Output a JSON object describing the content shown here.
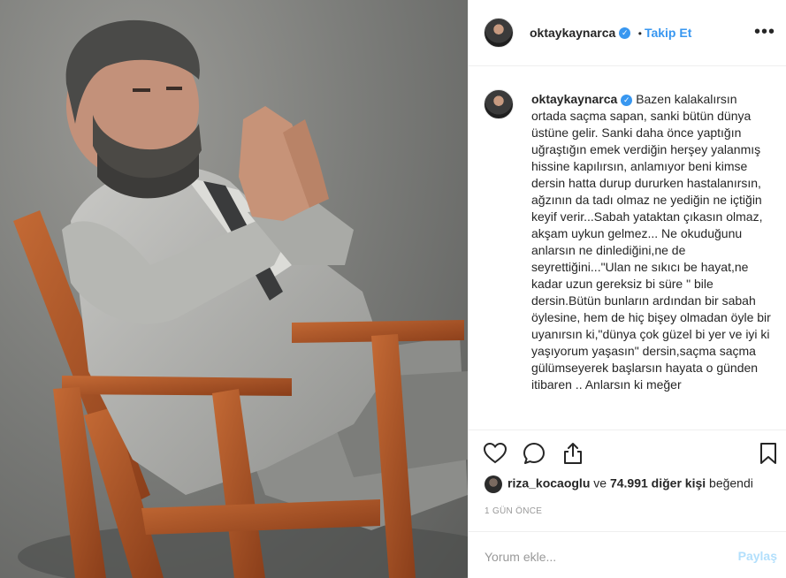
{
  "post": {
    "username": "oktaykaynarca",
    "separator": "•",
    "follow_label": "Takip Et",
    "more_icon": "more-horizontal-icon",
    "verified_icon": "verified-badge-icon",
    "caption": "Bazen kalakalırsın ortada saçma sapan, sanki bütün dünya üstüne gelir. Sanki daha önce yaptığın uğraştığın emek verdiğin herşey yalanmış hissine kapılırsın, anlamıyor beni kimse dersin hatta durup dururken hastalanırsın, ağzının da tadı olmaz ne yediğin ne içtiğin keyif verir...Sabah yataktan çıkasın olmaz, akşam uykun gelmez... Ne okuduğunu anlarsın ne dinlediğini,ne de seyrettiğini...\"Ulan ne sıkıcı be hayat,ne kadar uzun gereksiz bi süre \" bile dersin.Bütün bunların ardından bir sabah öylesine, hem de hiç bişey olmadan öyle bir uyanırsın ki,\"dünya çok güzel bi yer ve iyi ki yaşıyorum yaşasın\" dersin,saçma saçma gülümseyerek başlarsın hayata o günden itibaren .. Anlarsın ki meğer"
  },
  "actions": {
    "like_icon": "heart-icon",
    "comment_icon": "comment-icon",
    "share_icon": "share-icon",
    "save_icon": "bookmark-icon"
  },
  "likes": {
    "liker": "riza_kocaoglu",
    "connector": "ve",
    "count_text": "74.991 diğer kişi",
    "suffix": "beğendi"
  },
  "timestamp": "1 GÜN ÖNCE",
  "comment_box": {
    "placeholder": "Yorum ekle...",
    "submit_label": "Paylaş"
  },
  "colors": {
    "accent": "#3897f0",
    "submit_disabled": "#b2dffc",
    "muted": "#999999",
    "border": "#efefef"
  }
}
